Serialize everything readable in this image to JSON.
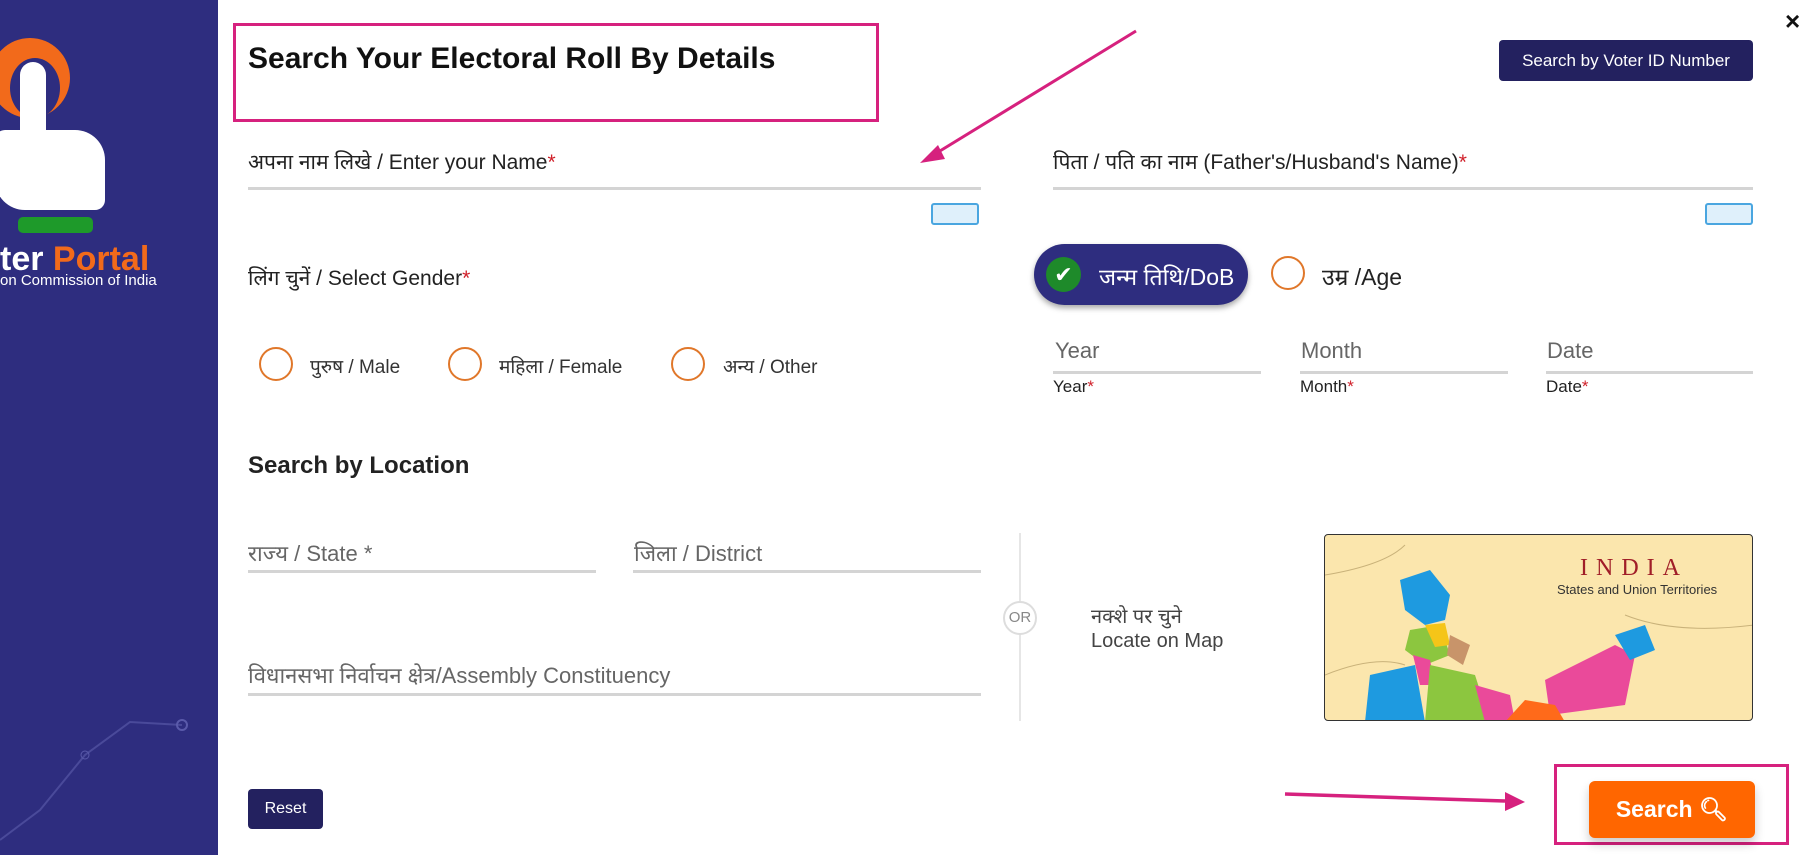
{
  "sidebar": {
    "logo_title_dark": "ter",
    "logo_title_accent": "Portal",
    "logo_subtitle": "on Commission of India"
  },
  "header": {
    "title": "Search Your Electoral Roll By Details",
    "voter_id_button": "Search by Voter ID Number",
    "close_icon": "×"
  },
  "form": {
    "name_label": "अपना नाम लिखे / Enter your Name",
    "father_label": "पिता / पति का नाम (Father's/Husband's Name)",
    "required_mark": "*",
    "gender_label": "लिंग चुनें / Select Gender",
    "gender_options": [
      "पुरुष / Male",
      "महिला / Female",
      "अन्य / Other"
    ],
    "dob_option": "जन्म तिथि/DoB",
    "age_option": "उम्र /Age",
    "dob_selected": true,
    "year_placeholder": "Year",
    "month_placeholder": "Month",
    "date_placeholder": "Date",
    "year_label": "Year",
    "month_label": "Month",
    "date_label": "Date"
  },
  "location": {
    "heading": "Search by Location",
    "state_placeholder": "राज्य / State *",
    "district_placeholder": "जिला / District",
    "assembly_placeholder": "विधानसभा निर्वाचन क्षेत्र/Assembly Constituency",
    "or_label": "OR",
    "map_label_hi": "नक्शे पर चुने",
    "map_label_en": "Locate on Map",
    "map_title": "INDIA",
    "map_subtitle": "States and Union Territories"
  },
  "actions": {
    "reset": "Reset",
    "search": "Search"
  },
  "colors": {
    "sidebar": "#2e2d7f",
    "accent_orange": "#ff6600",
    "annotation": "#d6217e",
    "dark_button": "#23215f"
  }
}
